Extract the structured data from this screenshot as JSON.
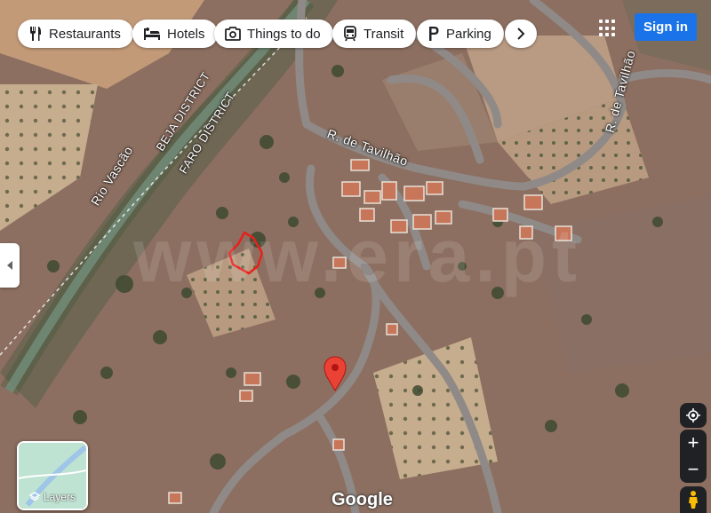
{
  "chips": [
    {
      "label": "Restaurants",
      "icon": "fork-knife-icon"
    },
    {
      "label": "Hotels",
      "icon": "bed-icon"
    },
    {
      "label": "Things to do",
      "icon": "camera-icon"
    },
    {
      "label": "Transit",
      "icon": "train-icon"
    },
    {
      "label": "Parking",
      "icon": "parking-icon"
    }
  ],
  "header": {
    "signin_label": "Sign in"
  },
  "map": {
    "labels": {
      "river": "Rio Vascão",
      "district_beja": "BEJA DISTRICT",
      "district_faro": "FARO DISTRICT",
      "street_1": "R. de Tavilhão",
      "street_2": "R. de Tavilhão"
    },
    "watermark": "www.era.pt",
    "attribution": "Google"
  },
  "controls": {
    "layers_label": "Layers",
    "zoom_in": "+",
    "zoom_out": "−"
  },
  "colors": {
    "accent": "#1a73e8",
    "pin": "#ea4335",
    "boundary": "#e8211c"
  }
}
